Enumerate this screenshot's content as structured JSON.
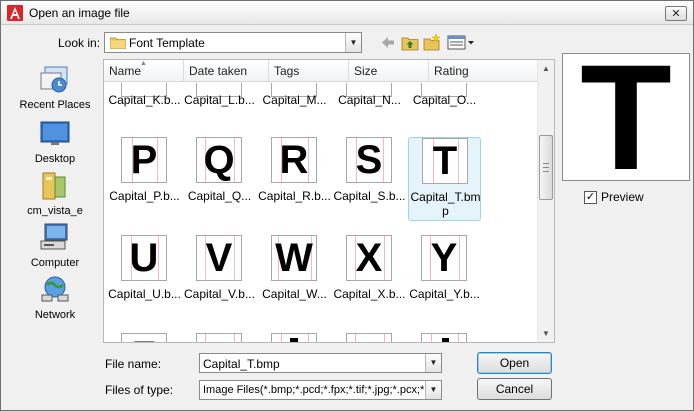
{
  "window": {
    "title": "Open an image file",
    "close_glyph": "✕"
  },
  "toolbar": {
    "look_in_label": "Look in:",
    "look_in_value": "Font Template",
    "dropdown_glyph": "▼"
  },
  "places": [
    {
      "label": "Recent Places",
      "icon": "recent-places-icon"
    },
    {
      "label": "Desktop",
      "icon": "desktop-icon"
    },
    {
      "label": "cm_vista_e",
      "icon": "user-folder-icon"
    },
    {
      "label": "Computer",
      "icon": "computer-icon"
    },
    {
      "label": "Network",
      "icon": "network-icon"
    }
  ],
  "columns": {
    "name": "Name",
    "date": "Date taken",
    "tags": "Tags",
    "size": "Size",
    "rating": "Rating",
    "sort_glyph": "▲"
  },
  "files": {
    "row0": [
      "Capital_K.b...",
      "Capital_L.b...",
      "Capital_M...",
      "Capital_N...",
      "Capital_O..."
    ],
    "row1": [
      {
        "glyph": "P",
        "name": "Capital_P.b..."
      },
      {
        "glyph": "Q",
        "name": "Capital_Q..."
      },
      {
        "glyph": "R",
        "name": "Capital_R.b..."
      },
      {
        "glyph": "S",
        "name": "Capital_S.b..."
      },
      {
        "glyph": "T",
        "name": "Capital_T.bmp"
      }
    ],
    "row2": [
      {
        "glyph": "U",
        "name": "Capital_U.b..."
      },
      {
        "glyph": "V",
        "name": "Capital_V.b..."
      },
      {
        "glyph": "W",
        "name": "Capital_W..."
      },
      {
        "glyph": "X",
        "name": "Capital_X.b..."
      },
      {
        "glyph": "Y",
        "name": "Capital_Y.b..."
      }
    ],
    "row3": [
      "Z",
      "",
      "",
      "",
      ""
    ],
    "selected": "Capital_T.bmp"
  },
  "scrollbar": {
    "up_glyph": "▲",
    "down_glyph": "▼"
  },
  "preview": {
    "glyph": "T",
    "label": "Preview",
    "checked": true,
    "check_glyph": "✓"
  },
  "bottom": {
    "file_name_label": "File name:",
    "file_name_value": "Capital_T.bmp",
    "file_type_label": "Files of type:",
    "file_type_value": "Image Files(*.bmp;*.pcd;*.fpx;*.tif;*.jpg;*.pcx;*.wmf;*.png)",
    "open_label": "Open",
    "cancel_label": "Cancel"
  },
  "colors": {
    "selection_fill": "#e5f3fb",
    "selection_border": "#9fd2ee",
    "dialog_bg": "#f0f0f0",
    "guide_line": "#f3b8c4"
  }
}
